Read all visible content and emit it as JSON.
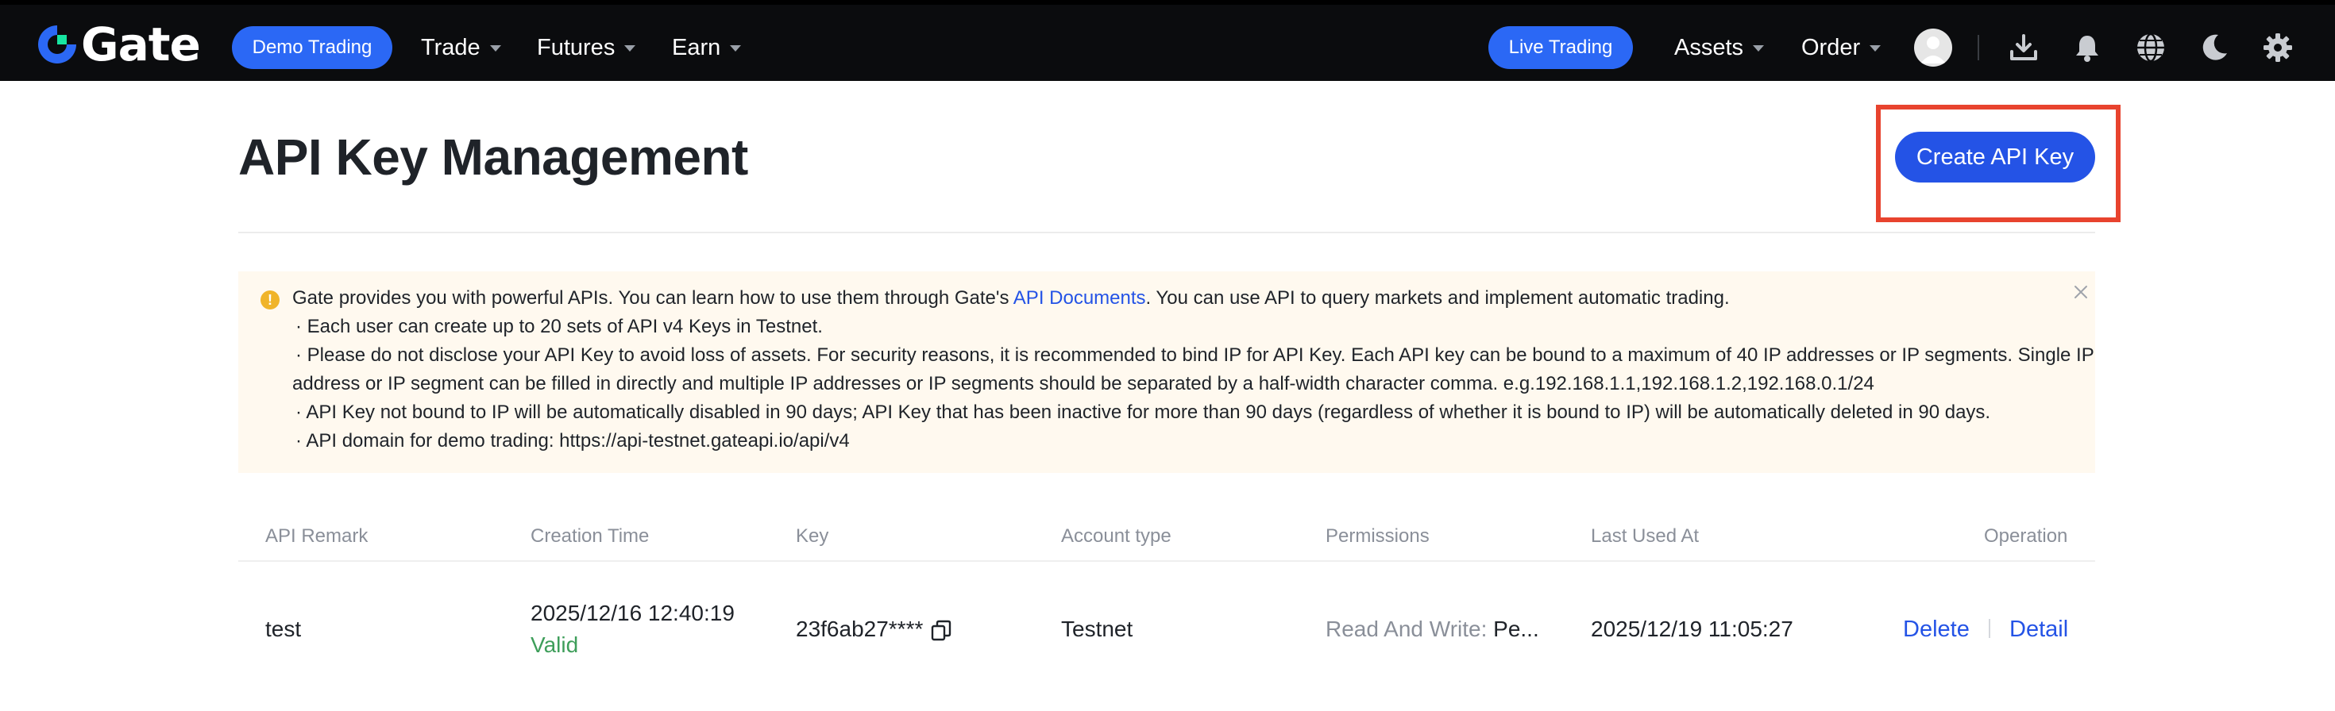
{
  "brand": {
    "name": "Gate",
    "accent": "#2b68f5",
    "button_blue": "#2453e6",
    "highlight": "#e8432e"
  },
  "navbar": {
    "demo_trading": "Demo Trading",
    "menu": [
      {
        "label": "Trade"
      },
      {
        "label": "Futures"
      },
      {
        "label": "Earn"
      }
    ],
    "live_trading": "Live Trading",
    "right_menu": [
      {
        "label": "Assets"
      },
      {
        "label": "Order"
      }
    ],
    "icons": [
      "avatar-icon",
      "download-icon",
      "bell-icon",
      "globe-icon",
      "moon-icon",
      "gear-icon"
    ]
  },
  "page": {
    "title": "API Key Management",
    "create_button": "Create API Key"
  },
  "notice": {
    "intro_before": "Gate provides you with powerful APIs. You can learn how to use them through Gate's ",
    "intro_link": "API Documents",
    "intro_after": ". You can use API to query markets and implement automatic trading.",
    "bullets": [
      "· Each user can create up to 20 sets of API v4 Keys in Testnet.",
      "· Please do not disclose your API Key to avoid loss of assets. For security reasons, it is recommended to bind IP for API Key. Each API key can be bound to a maximum of 40 IP addresses or IP segments. Single IP",
      "address or IP segment can be filled in directly and multiple IP addresses or IP segments should be separated by a half-width character comma. e.g.192.168.1.1,192.168.1.2,192.168.0.1/24",
      "· API Key not bound to IP will be automatically disabled in 90 days; API Key that has been inactive for more than 90 days (regardless of whether it is bound to IP) will be automatically deleted in 90 days.",
      "· API domain for demo trading: https://api-testnet.gateapi.io/api/v4"
    ]
  },
  "table": {
    "headers": {
      "remark": "API Remark",
      "created": "Creation Time",
      "key": "Key",
      "account": "Account type",
      "permissions": "Permissions",
      "last_used": "Last Used At",
      "operation": "Operation"
    },
    "rows": [
      {
        "remark": "test",
        "created": "2025/12/16 12:40:19",
        "status": "Valid",
        "key": "23f6ab27****",
        "account": "Testnet",
        "perm_label": "Read And Write:",
        "perm_value": " Pe...",
        "last_used": "2025/12/19 11:05:27",
        "delete": "Delete",
        "detail": "Detail"
      }
    ]
  }
}
